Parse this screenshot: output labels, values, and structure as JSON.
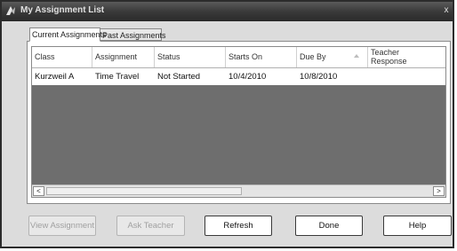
{
  "window": {
    "title": "My Assignment List",
    "close_glyph": "x"
  },
  "tabs": [
    {
      "label": "Current Assignments",
      "active": true
    },
    {
      "label": "Past Assignments",
      "active": false
    }
  ],
  "table": {
    "columns": [
      "Class",
      "Assignment",
      "Status",
      "Starts On",
      "Due By",
      "Teacher Response"
    ],
    "sorted_column": "Due By",
    "rows": [
      [
        "Kurzweil A",
        "Time Travel",
        "Not Started",
        "10/4/2010",
        "10/8/2010",
        ""
      ]
    ]
  },
  "scrollbar": {
    "left_glyph": "<",
    "right_glyph": ">"
  },
  "buttons": {
    "view_assignment": "View Assignment",
    "ask_teacher": "Ask Teacher",
    "refresh": "Refresh",
    "done": "Done",
    "help": "Help"
  },
  "colors": {
    "titlebar": "#3a3a3a",
    "grid_empty": "#6e6e6e",
    "dialog_bg": "#dcdcdc"
  }
}
